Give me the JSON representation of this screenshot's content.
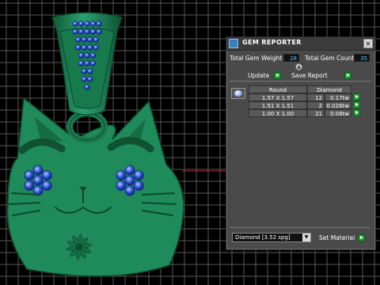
{
  "panel": {
    "title": "Gem Reporter",
    "close_label": "×",
    "total_weight_label": "Total Gem Weight",
    "total_weight_value": "28",
    "total_count_label": "Total Gem Count",
    "total_count_value": "35",
    "update_label": "Update",
    "save_report_label": "Save Report",
    "table": {
      "headers": [
        "Round",
        "Diamond"
      ],
      "rows": [
        {
          "size": "1.57 X 1.57",
          "count": "12",
          "weight": "0.17tw"
        },
        {
          "size": "1.51 X 1.51",
          "count": "2",
          "weight": "0.026tw"
        },
        {
          "size": "1.00 X 1.00",
          "count": "21",
          "weight": "0.08tw"
        }
      ]
    },
    "material_selected": "Diamond   [3.52 spg]",
    "set_material_label": "Set Material"
  },
  "colors": {
    "model_green": "#1f8a5a",
    "grid_line": "#5a5a5a",
    "gem_blue": "#2e54d8",
    "action_green": "#22a038",
    "value_blue": "#4fc8ff"
  },
  "icons": [
    "gem-reporter-icon",
    "close-icon",
    "expand-icon",
    "play-icon",
    "chevron-down-icon",
    "gem-thumbnail-icon"
  ]
}
